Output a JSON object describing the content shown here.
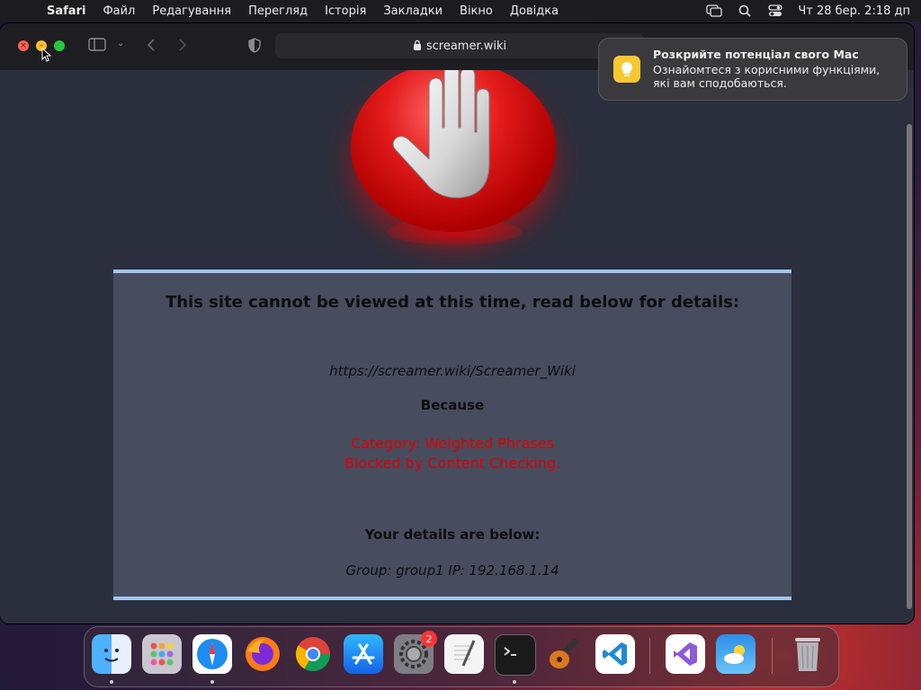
{
  "menubar": {
    "items": [
      "Safari",
      "Файл",
      "Редагування",
      "Перегляд",
      "Історія",
      "Закладки",
      "Вікно",
      "Довідка"
    ],
    "clock": "Чт 28 бер.  2:18 дп"
  },
  "browser": {
    "address": "screamer.wiki"
  },
  "notice": {
    "heading": "This site cannot be viewed at this time, read below for details:",
    "url": "https://screamer.wiki/Screamer_Wiki",
    "because": "Because",
    "reason_line1": "Category: Weighted Phrases",
    "reason_line2": "Blocked by Content Checking.",
    "details_heading": "Your details are below:",
    "details": "Group: group1   IP: 192.168.1.14",
    "colors": {
      "reason": "#e00000",
      "border": "#9fc6ee",
      "panel": "#474c5f"
    }
  },
  "notification": {
    "title": "Розкрийте потенціал свого Mac",
    "body": "Ознайомтеся з корисними функціями, які вам сподобаються."
  },
  "dock": {
    "system_settings_badge": "2",
    "icons": [
      "finder-icon",
      "launchpad-icon",
      "safari-icon",
      "firefox-icon",
      "chrome-icon",
      "app-store-icon",
      "system-settings-icon",
      "textedit-icon",
      "terminal-icon",
      "garageband-icon",
      "vscode-icon",
      "visual-studio-icon",
      "weather-icon",
      "trash-icon"
    ]
  }
}
